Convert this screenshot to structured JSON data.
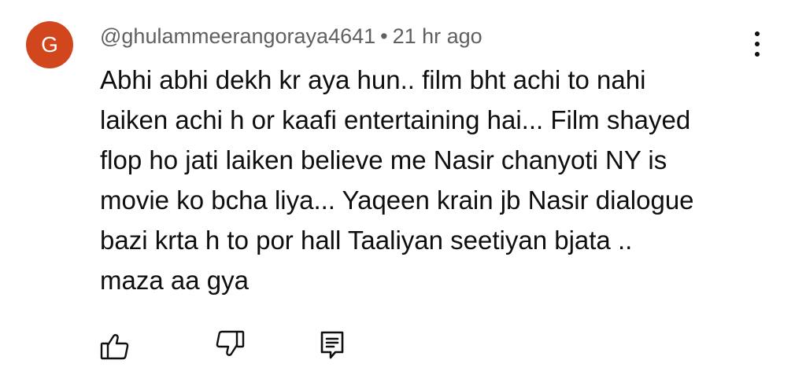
{
  "comment": {
    "avatar_letter": "G",
    "avatar_color": "#d1461d",
    "author": "@ghulammeerangoraya4641",
    "separator": "•",
    "time": "21 hr ago",
    "text_lines": [
      "Abhi abhi dekh kr aya hun.. film bht achi to nahi",
      "laiken achi h or kaafi entertaining hai... Film shayed",
      "flop ho jati laiken believe me Nasir chanyoti NY is",
      "movie ko bcha liya... Yaqeen krain jb Nasir dialogue",
      "bazi krta h to por hall Taaliyan seetiyan bjata ..",
      "maza aa gya"
    ],
    "actions": {
      "like_icon": "thumbs-up-icon",
      "dislike_icon": "thumbs-down-icon",
      "reply_icon": "reply-comment-icon",
      "menu_icon": "more-vert-icon"
    }
  }
}
